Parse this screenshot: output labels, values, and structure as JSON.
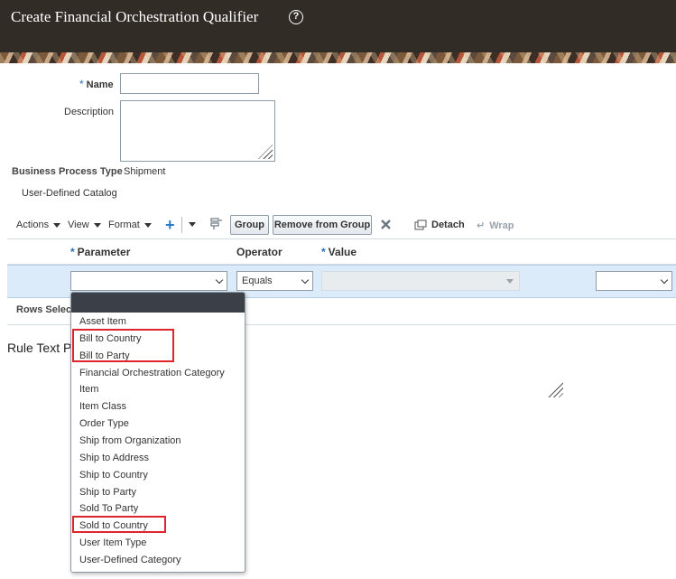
{
  "header": {
    "title": "Create Financial Orchestration Qualifier",
    "help_glyph": "?"
  },
  "form": {
    "name_label": "Name",
    "required_mark": "*",
    "name_value": "",
    "description_label": "Description",
    "description_value": "",
    "bpt_label": "Business Process Type",
    "bpt_value": "Shipment",
    "catalog_label": "User-Defined Catalog"
  },
  "toolbar": {
    "actions": "Actions",
    "view": "View",
    "format": "Format",
    "add_glyph": "+",
    "group": "Group",
    "remove_from_group": "Remove from Group",
    "detach": "Detach",
    "wrap": "Wrap"
  },
  "table": {
    "columns": [
      "Parameter",
      "Operator",
      "Value"
    ],
    "row": {
      "parameter": "",
      "operator": "Equals",
      "value": "",
      "extra": ""
    },
    "rows_selected_label": "Rows Selected"
  },
  "rule_text_label": "Rule Text P",
  "dropdown": {
    "options": [
      "Asset Item",
      "Bill to Country",
      "Bill to Party",
      "Financial Orchestration Category",
      "Item",
      "Item Class",
      "Order Type",
      "Ship from Organization",
      "Ship to Address",
      "Ship to Country",
      "Ship to Party",
      "Sold To Party",
      "Sold to Country",
      "User Item Type",
      "User-Defined Category"
    ],
    "highlighted": [
      "Bill to Country",
      "Bill to Party",
      "Sold to Country"
    ]
  },
  "colors": {
    "header_bg": "#322c27",
    "selected_row": "#dcebf9",
    "highlight_box": "#e0242b",
    "accent": "#2a7ac9"
  }
}
